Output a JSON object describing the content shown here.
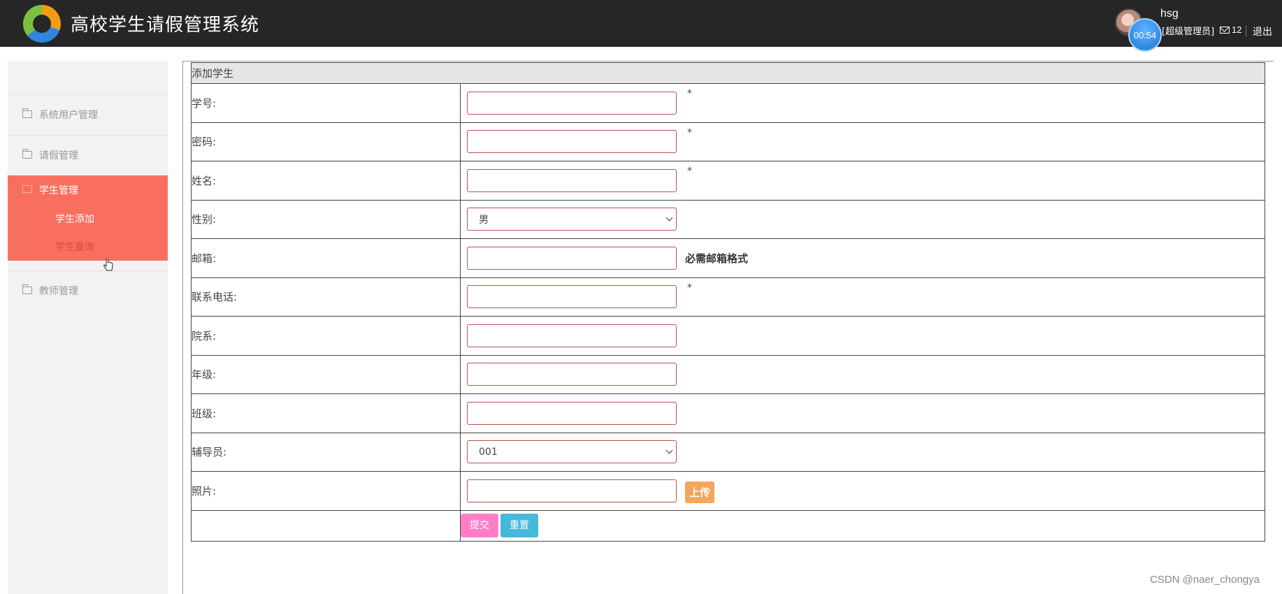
{
  "header": {
    "title": "高校学生请假管理系统",
    "username": "hsg",
    "role": "[超级管理员]",
    "mail_count": "12",
    "logout": "退出",
    "timer": "00:54"
  },
  "sidebar": {
    "items": [
      {
        "label": "系统用户管理"
      },
      {
        "label": "请假管理"
      },
      {
        "label": "学生管理",
        "active": true,
        "children": [
          {
            "label": "学生添加"
          },
          {
            "label": "学生查询"
          }
        ]
      },
      {
        "label": "教师管理"
      }
    ]
  },
  "form": {
    "title": "添加学生",
    "fields": {
      "student_id": {
        "label": "学号:",
        "value": "",
        "required_mark": "*"
      },
      "password": {
        "label": "密码:",
        "value": "",
        "required_mark": "*"
      },
      "name": {
        "label": "姓名:",
        "value": "",
        "required_mark": "*"
      },
      "gender": {
        "label": "性别:",
        "selected": "男"
      },
      "email": {
        "label": "邮箱:",
        "value": "",
        "hint": "必需邮箱格式"
      },
      "phone": {
        "label": "联系电话:",
        "value": "",
        "required_mark": "*"
      },
      "department": {
        "label": "院系:",
        "value": ""
      },
      "grade": {
        "label": "年级:",
        "value": ""
      },
      "class": {
        "label": "班级:",
        "value": ""
      },
      "counselor": {
        "label": "辅导员:",
        "selected": "001"
      },
      "photo": {
        "label": "照片:",
        "value": "",
        "upload_label": "上传"
      }
    },
    "submit_label": "提交",
    "reset_label": "重置"
  },
  "watermark": "CSDN @naer_chongya",
  "colors": {
    "header_bg": "#262626",
    "sidebar_bg": "#f2f2f2",
    "active_menu": "#f96f5f",
    "submit": "#ff7ec7",
    "reset": "#46b8da",
    "upload": "#f6a55a",
    "input_border": "#c0504d"
  }
}
